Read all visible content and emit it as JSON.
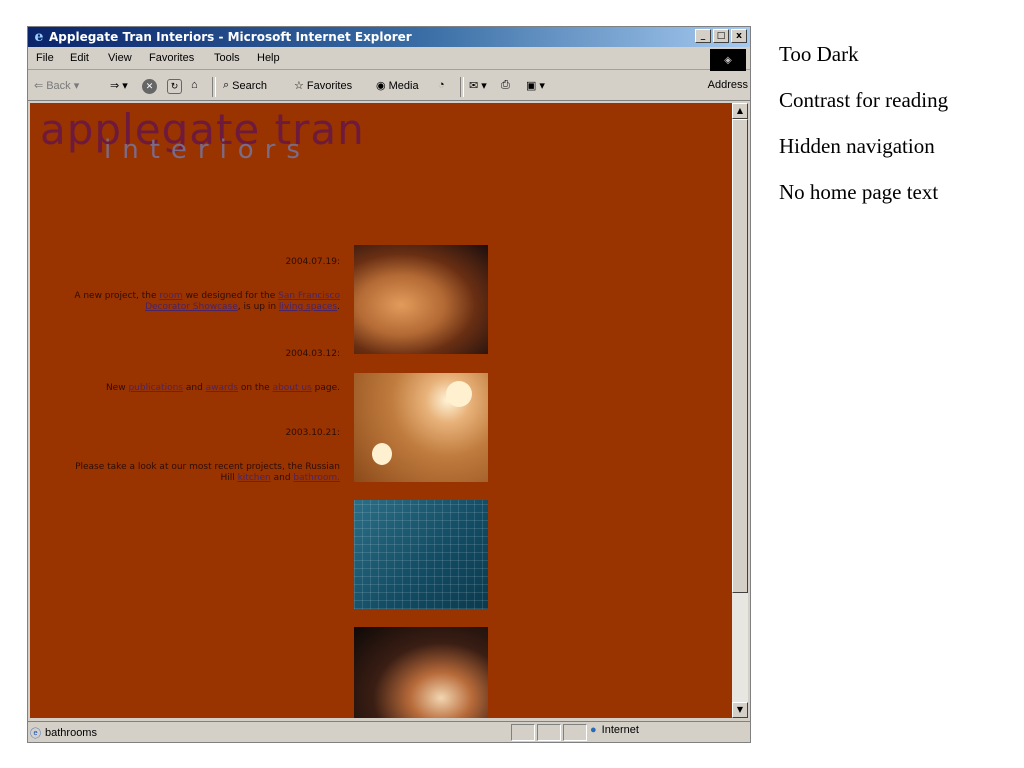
{
  "window": {
    "title": "Applegate Tran Interiors - Microsoft Internet Explorer",
    "buttons": [
      "_",
      "□",
      "x"
    ]
  },
  "menu": [
    "File",
    "Edit",
    "View",
    "Favorites",
    "Tools",
    "Help"
  ],
  "toolbar": {
    "back": "Back",
    "search": "Search",
    "favorites": "Favorites",
    "media": "Media",
    "address": "Address"
  },
  "page": {
    "logo_main": "applegate tran",
    "logo_sub": "interiors",
    "news": [
      {
        "date": "2004.07.19:",
        "text_parts": [
          "A new project, the ",
          "room",
          " we designed for the ",
          "San Francisco Decorator Showcase",
          ", is up in ",
          "living spaces",
          "."
        ]
      },
      {
        "date": "2004.03.12:",
        "text_parts": [
          "New ",
          "publications",
          " and ",
          "awards",
          " on the ",
          "about us",
          " page."
        ]
      },
      {
        "date": "2003.10.21:",
        "text_parts": [
          "Please take a look at our most recent projects, the Russian Hill ",
          "kitchen",
          " and ",
          "bathroom."
        ]
      }
    ]
  },
  "status": {
    "text": "bathrooms",
    "zone": "Internet"
  },
  "notes": [
    "Too Dark",
    "Contrast for reading",
    "Hidden navigation",
    "No home page text"
  ]
}
